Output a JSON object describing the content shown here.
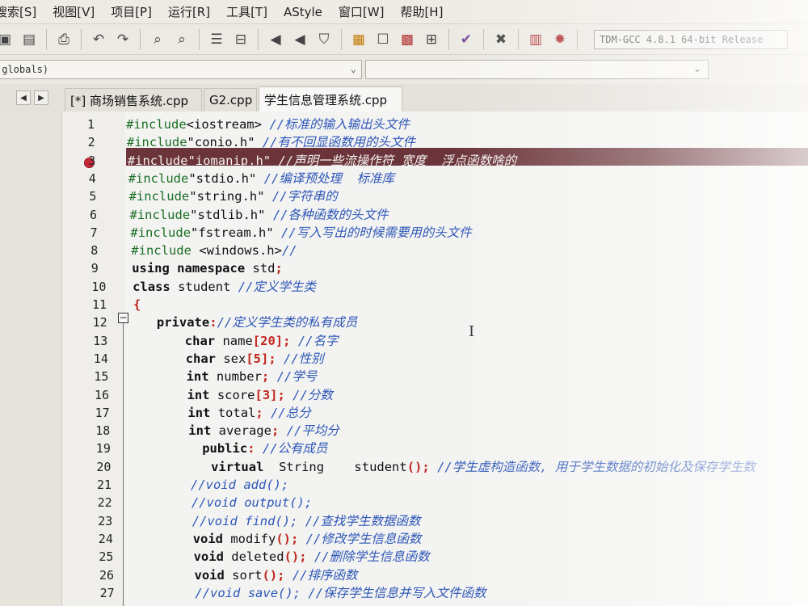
{
  "menu": [
    "搜索[S]",
    "视图[V]",
    "项目[P]",
    "运行[R]",
    "工具[T]",
    "AStyle",
    "窗口[W]",
    "帮助[H]"
  ],
  "toolbar": {
    "compiler": "TDM-GCC 4.8.1 64-bit Release"
  },
  "scope": {
    "value": "(globals)"
  },
  "tabs": [
    {
      "label": "[*] 商场销售系统.cpp",
      "active": false
    },
    {
      "label": "G2.cpp",
      "active": false
    },
    {
      "label": "学生信息管理系统.cpp",
      "active": true
    }
  ],
  "editor": {
    "line_numbers": [
      "1",
      "2",
      "3",
      "4",
      "5",
      "6",
      "7",
      "8",
      "9",
      "10",
      "11",
      "12",
      "13",
      "14",
      "15",
      "16",
      "17",
      "18",
      "19",
      "20",
      "21",
      "22",
      "23",
      "24",
      "25",
      "26",
      "27"
    ],
    "lines": [
      {
        "pp": "#include",
        "st": "<iostream>",
        "cm": " //标准的输入输出头文件"
      },
      {
        "pp": "#include",
        "st": "\"conio.h\"",
        "cm": " //有不回显函数用的头文件"
      },
      {
        "pp": "#include",
        "st": "\"iomanip.h\"",
        "cm": " //声明一些流操作符 宽度  浮点函数啥的"
      },
      {
        "pp": "#include",
        "st": "\"stdio.h\"",
        "cm": " //编译预处理  标准库"
      },
      {
        "pp": "#include",
        "st": "\"string.h\"",
        "cm": " //字符串的"
      },
      {
        "pp": "#include",
        "st": "\"stdlib.h\"",
        "cm": " //各种函数的头文件"
      },
      {
        "pp": "#include",
        "st": "\"fstream.h\"",
        "cm": " //写入写出的时候需要用的头文件"
      },
      {
        "pp": "#include",
        "st": " <windows.h>",
        "cm": "//"
      },
      {
        "kw": "using namespace",
        "txt": " std",
        "sym": ";"
      },
      {
        "kw": "class",
        "txt": " student ",
        "cm": "//定义学生类"
      },
      {
        "sym": "{"
      },
      {
        "kw": "private",
        "sym": ":",
        "cm": "//定义学生类的私有成员"
      },
      {
        "kw": "char",
        "txt": " name",
        "sym": "[20];",
        "cm": " //名字"
      },
      {
        "kw": "char",
        "txt": " sex",
        "sym": "[5];",
        "cm": " //性别"
      },
      {
        "kw": "int",
        "txt": " number",
        "sym": ";",
        "cm": " //学号"
      },
      {
        "kw": "int",
        "txt": " score",
        "sym": "[3];",
        "cm": " //分数"
      },
      {
        "kw": "int",
        "txt": " total",
        "sym": ";",
        "cm": " //总分"
      },
      {
        "kw": "int",
        "txt": " average",
        "sym": ";",
        "cm": " //平均分"
      },
      {
        "kw": "public",
        "sym": ":",
        "cm": " //公有成员"
      },
      {
        "kw": "virtual",
        "txt": "  String    student",
        "sym": "();",
        "cm": " //学生虚构造函数, 用于学生数据的初始化及保存学生数"
      },
      {
        "cm": "//void add();"
      },
      {
        "cm": "//void output();"
      },
      {
        "cm": "//void find(); //查找学生数据函数"
      },
      {
        "kw": "void",
        "txt": " modify",
        "sym": "();",
        "cm": " //修改学生信息函数"
      },
      {
        "kw": "void",
        "txt": " deleted",
        "sym": "();",
        "cm": " //删除学生信息函数"
      },
      {
        "kw": "void",
        "txt": " sort",
        "sym": "();",
        "cm": " //排序函数"
      },
      {
        "cm": "//void save(); //保存学生信息并写入文件函数"
      }
    ]
  },
  "colors": {
    "highlight_line": "#6a343a",
    "comment": "#2e57b8",
    "preprocessor": "#1a6e24",
    "symbol": "#c0271f"
  }
}
